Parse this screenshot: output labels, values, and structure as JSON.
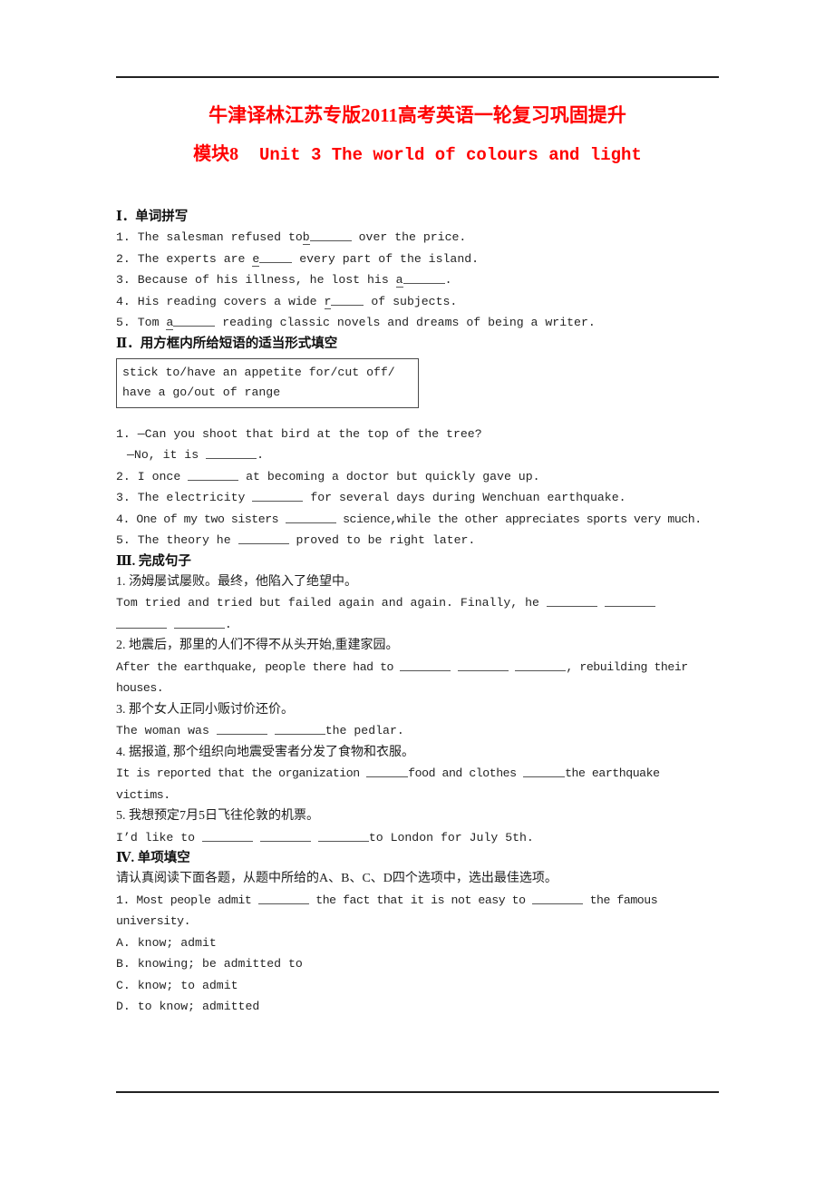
{
  "document": {
    "title_main": "牛津译林江苏专版2011高考英语一轮复习巩固提升",
    "title_sub_cn": "模块8",
    "title_sub_en": "Unit 3  The world of colours and light",
    "accent_color": "#ff0000",
    "rule_color": "#222222"
  },
  "sections": {
    "s1": {
      "heading": "Ⅰ．单词拼写",
      "items": [
        {
          "num": "1.",
          "pre": "The salesman refused to",
          "hint": "b",
          "post": "over the price."
        },
        {
          "num": "2.",
          "pre": "The experts are",
          "hint": "e",
          "post": "every part of the island."
        },
        {
          "num": "3.",
          "pre": "Because of his illness, he lost his",
          "hint": "a",
          "post": "."
        },
        {
          "num": "4.",
          "pre": "His reading covers a wide",
          "hint": "r",
          "post": "of subjects."
        },
        {
          "num": "5.",
          "pre": "Tom",
          "hint": "a",
          "post": "reading classic novels and dreams of being a writer."
        }
      ]
    },
    "s2": {
      "heading": "Ⅱ．用方框内所给短语的适当形式填空",
      "phrase_box": [
        "stick to/have an appetite for/cut off/",
        "have a go/out of range"
      ],
      "items": [
        {
          "num": "1.",
          "q": "—Can you shoot that bird at the top of the tree?",
          "a_pre": "—No, it is",
          "a_post": "."
        },
        {
          "num": "2.",
          "pre": "I once",
          "post": "at becoming a doctor but quickly gave up."
        },
        {
          "num": "3.",
          "pre": "The electricity",
          "post": "for several days during Wenchuan earthquake."
        },
        {
          "num": "4.",
          "pre": "One of my two sisters",
          "post": "science,while the other appreciates sports very much."
        },
        {
          "num": "5.",
          "pre": "The theory he",
          "post": "proved to be right later."
        }
      ]
    },
    "s3": {
      "heading": "Ⅲ. 完成句子",
      "items": [
        {
          "num": "1.",
          "cn": "汤姆屡试屡败。最终，他陷入了绝望中。",
          "en_pre": "Tom tried and tried but failed again and again.  Finally, he",
          "en_post": "."
        },
        {
          "num": "2.",
          "cn": "地震后，那里的人们不得不从头开始,重建家园。",
          "en_pre": "After the earthquake, people there had to",
          "en_post": ", rebuilding their houses."
        },
        {
          "num": "3.",
          "cn": "那个女人正同小贩讨价还价。",
          "en_pre": "The woman was",
          "en_post": "the pedlar."
        },
        {
          "num": "4.",
          "cn": "据报道, 那个组织向地震受害者分发了食物和衣服。",
          "en_pre": "It is reported that the organization",
          "en_mid": "food and clothes",
          "en_post": "the earthquake victims."
        },
        {
          "num": "5.",
          "cn": "我想预定7月5日飞往伦敦的机票。",
          "en_pre": "I’d like to",
          "en_post": "to London for July 5th."
        }
      ]
    },
    "s4": {
      "heading": "Ⅳ. 单项填空",
      "instruction": "请认真阅读下面各题，从题中所给的A、B、C、D四个选项中，选出最佳选项。",
      "items": [
        {
          "num": "1.",
          "stem_pre": "Most people admit",
          "stem_mid": "the fact that it is not easy to",
          "stem_post": "the famous university.",
          "options": [
            {
              "key": "A.",
              "text": "know; admit"
            },
            {
              "key": "B.",
              "text": "knowing; be admitted to"
            },
            {
              "key": "C.",
              "text": "know; to admit"
            },
            {
              "key": "D.",
              "text": "to know; admitted"
            }
          ]
        }
      ]
    }
  }
}
